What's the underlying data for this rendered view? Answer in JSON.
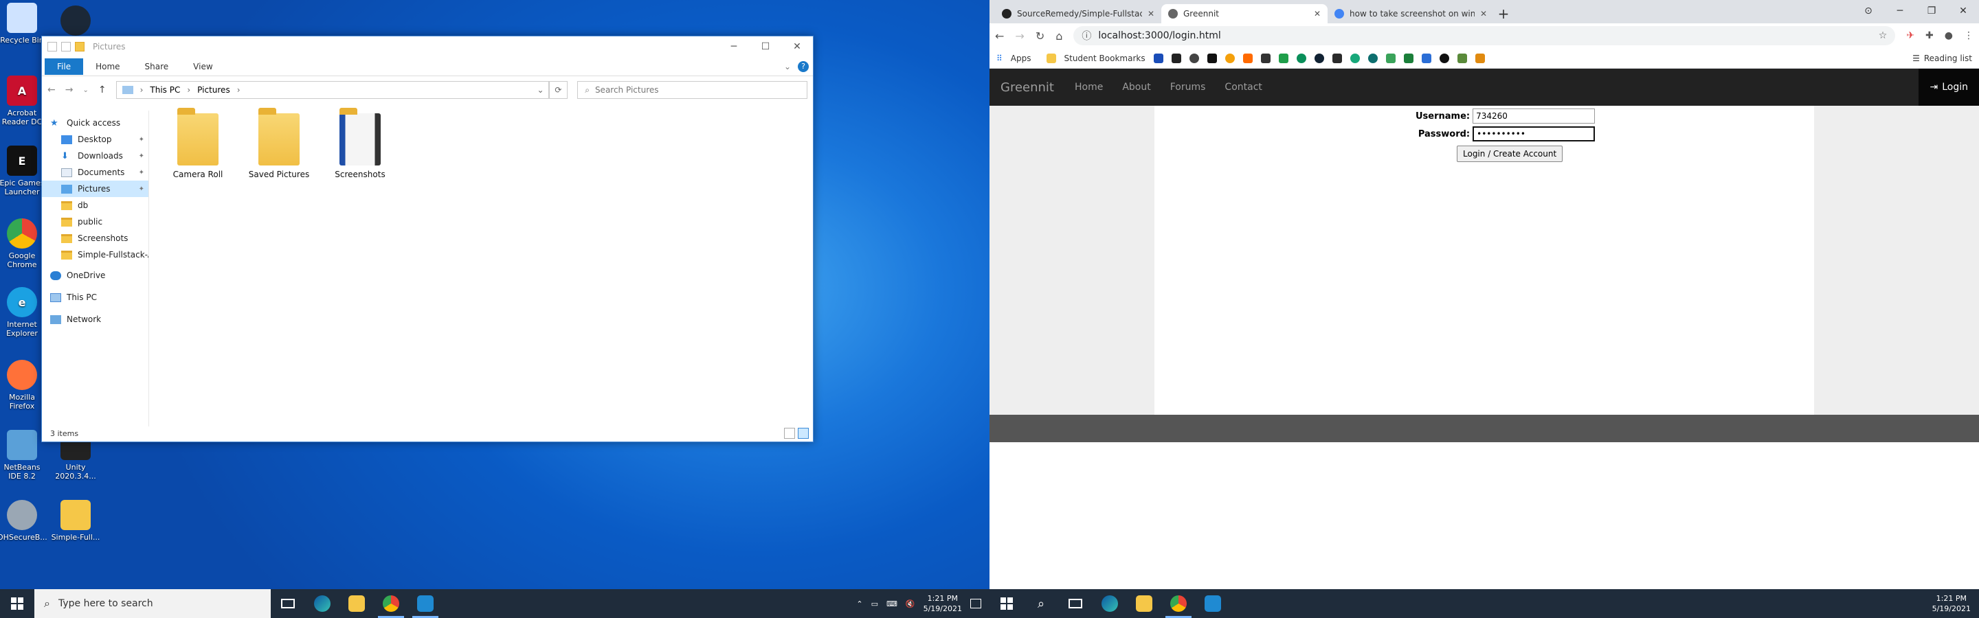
{
  "desktop": {
    "icons": [
      {
        "label": "Recycle Bin",
        "color": "#cfe3ff"
      },
      {
        "label": "Steam",
        "color": "#1b2838"
      },
      {
        "label": "Acrobat Reader DC",
        "color": "#c8102e"
      },
      {
        "label": "Epic Games Launcher",
        "color": "#111111"
      },
      {
        "label": "Google Chrome",
        "color": "#34a853"
      },
      {
        "label": "Internet Explorer",
        "color": "#1ba1e2"
      },
      {
        "label": "Mozilla Firefox",
        "color": "#ff7139"
      },
      {
        "label": "NetBeans IDE 8.2",
        "color": "#5aa0d8"
      },
      {
        "label": "Unity 2020.3.4...",
        "color": "#222222"
      },
      {
        "label": "OHSecureB...",
        "color": "#9aa7b4"
      },
      {
        "label": "Simple-Full...",
        "color": "#f5c748"
      }
    ]
  },
  "explorer": {
    "title": "Pictures",
    "ribbon_tabs": [
      "File",
      "Home",
      "Share",
      "View"
    ],
    "breadcrumb": [
      "This PC",
      "Pictures"
    ],
    "search_placeholder": "Search Pictures",
    "nav": [
      {
        "label": "Quick access",
        "pinned": false
      },
      {
        "label": "Desktop",
        "pinned": true
      },
      {
        "label": "Downloads",
        "pinned": true
      },
      {
        "label": "Documents",
        "pinned": true
      },
      {
        "label": "Pictures",
        "pinned": true,
        "selected": true
      },
      {
        "label": "db",
        "pinned": false
      },
      {
        "label": "public",
        "pinned": false
      },
      {
        "label": "Screenshots",
        "pinned": false
      },
      {
        "label": "Simple-Fullstack-Ap",
        "pinned": false
      },
      {
        "label": "OneDrive",
        "pinned": false
      },
      {
        "label": "This PC",
        "pinned": false
      },
      {
        "label": "Network",
        "pinned": false
      }
    ],
    "items": [
      "Camera Roll",
      "Saved Pictures",
      "Screenshots"
    ],
    "status": "3 items"
  },
  "taskbar_left": {
    "search_placeholder": "Type here to search",
    "time": "1:21 PM",
    "date": "5/19/2021"
  },
  "taskbar_right": {
    "time": "1:21 PM",
    "date": "5/19/2021"
  },
  "browser": {
    "tabs": [
      {
        "title": "SourceRemedy/Simple-Fullstack",
        "active": false
      },
      {
        "title": "Greennit",
        "active": true
      },
      {
        "title": "how to take screenshot on windo",
        "active": false
      }
    ],
    "url": "localhost:3000/login.html",
    "bookmarks_label": "Apps",
    "bookmarks_folder": "Student Bookmarks",
    "reading_list": "Reading list"
  },
  "site": {
    "brand": "Greennit",
    "nav": [
      "Home",
      "About",
      "Forums",
      "Contact"
    ],
    "login_label": "Login",
    "username_label": "Username:",
    "username_value": "734260",
    "password_label": "Password:",
    "password_value": "••••••••••",
    "submit_label": "Login / Create Account"
  }
}
